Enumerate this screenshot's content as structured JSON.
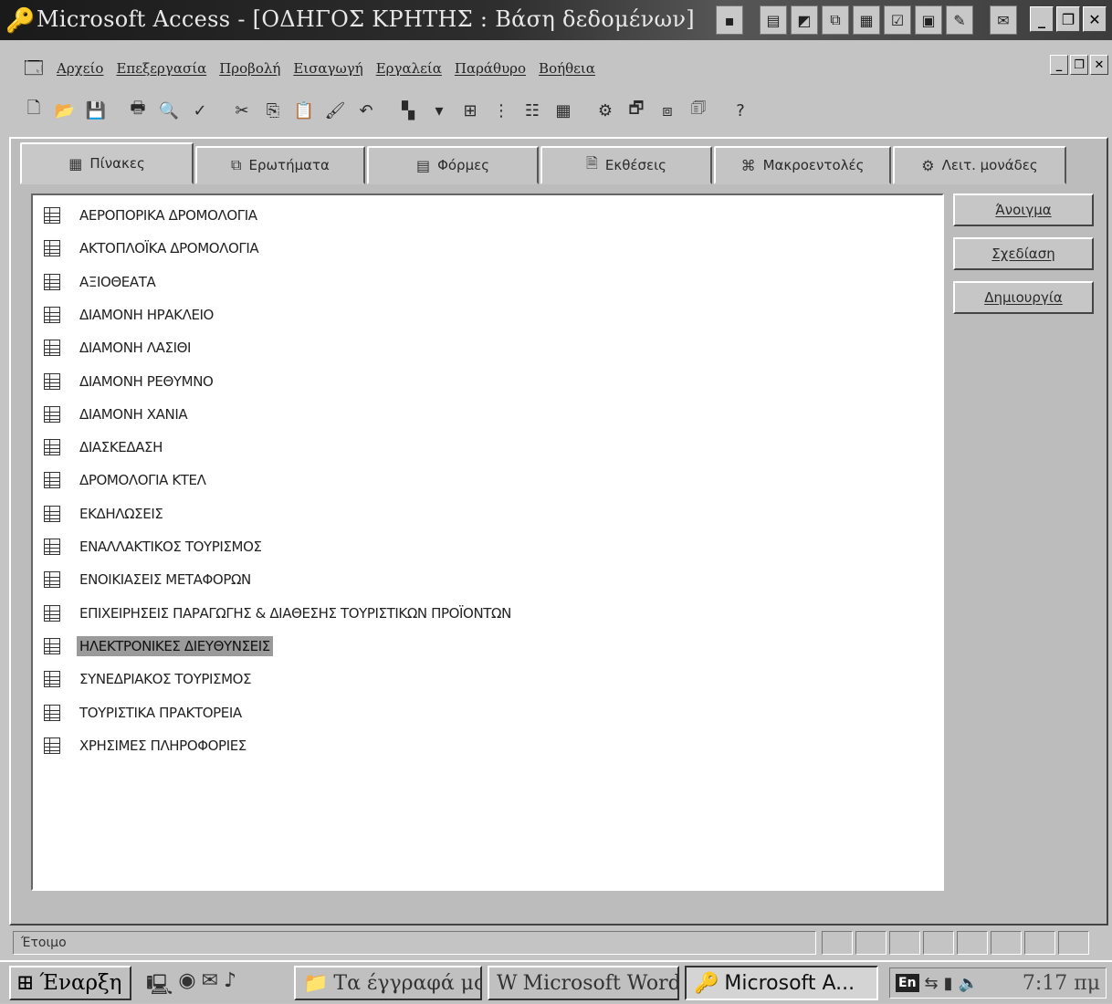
{
  "window": {
    "title": "Microsoft Access - [ΟΔΗΓΟΣ ΚΡΗΤΗΣ : Βάση δεδομένων]"
  },
  "menu": [
    "Αρχείο",
    "Επεξεργασία",
    "Προβολή",
    "Εισαγωγή",
    "Εργαλεία",
    "Παράθυρο",
    "Βοήθεια"
  ],
  "tabs": [
    {
      "label": "Πίνακες",
      "icon": "table-icon",
      "active": true
    },
    {
      "label": "Ερωτήματα",
      "icon": "query-icon",
      "active": false
    },
    {
      "label": "Φόρμες",
      "icon": "form-icon",
      "active": false
    },
    {
      "label": "Εκθέσεις",
      "icon": "report-icon",
      "active": false
    },
    {
      "label": "Μακροεντολές",
      "icon": "macro-icon",
      "active": false
    },
    {
      "label": "Λειτ. μονάδες",
      "icon": "module-icon",
      "active": false
    }
  ],
  "tables": [
    "ΑΕΡΟΠΟΡΙΚΑ ΔΡΟΜΟΛΟΓΙΑ",
    "ΑΚΤΟΠΛΟΪΚΑ ΔΡΟΜΟΛΟΓΙΑ",
    "ΑΞΙΟΘΕΑΤΑ",
    "ΔΙΑΜΟΝΗ ΗΡΑΚΛΕΙΟ",
    "ΔΙΑΜΟΝΗ ΛΑΣΙΘΙ",
    "ΔΙΑΜΟΝΗ ΡΕΘΥΜΝΟ",
    "ΔΙΑΜΟΝΗ ΧΑΝΙΑ",
    "ΔΙΑΣΚΕΔΑΣΗ",
    "ΔΡΟΜΟΛΟΓΙΑ ΚΤΕΛ",
    "ΕΚΔΗΛΩΣΕΙΣ",
    "ΕΝΑΛΛΑΚΤΙΚΟΣ ΤΟΥΡΙΣΜΟΣ",
    "ΕΝΟΙΚΙΑΣΕΙΣ ΜΕΤΑΦΟΡΩΝ",
    "ΕΠΙΧΕΙΡΗΣΕΙΣ ΠΑΡΑΓΩΓΗΣ & ΔΙΑΘΕΣΗΣ ΤΟΥΡΙΣΤΙΚΩΝ ΠΡΟΪΟΝΤΩΝ",
    "ΗΛΕΚΤΡΟΝΙΚΕΣ ΔΙΕΥΘΥΝΣΕΙΣ",
    "ΣΥΝΕΔΡΙΑΚΟΣ ΤΟΥΡΙΣΜΟΣ",
    "ΤΟΥΡΙΣΤΙΚΑ ΠΡΑΚΤΟΡΕΙΑ",
    "ΧΡΗΣΙΜΕΣ ΠΛΗΡΟΦΟΡΙΕΣ"
  ],
  "selected_table": "ΗΛΕΚΤΡΟΝΙΚΕΣ ΔΙΕΥΘΥΝΣΕΙΣ",
  "buttons": {
    "open": "Άνοιγμα",
    "design": "Σχεδίαση",
    "new": "Δημιουργία"
  },
  "status": {
    "text": "Έτοιμο"
  },
  "taskbar": {
    "start": "Έναρξη",
    "items": [
      "Τα έγγραφά μου",
      "Microsoft Word",
      "Microsoft A..."
    ],
    "active_item": "Microsoft A...",
    "lang": "En",
    "clock": "7:17 πμ"
  }
}
